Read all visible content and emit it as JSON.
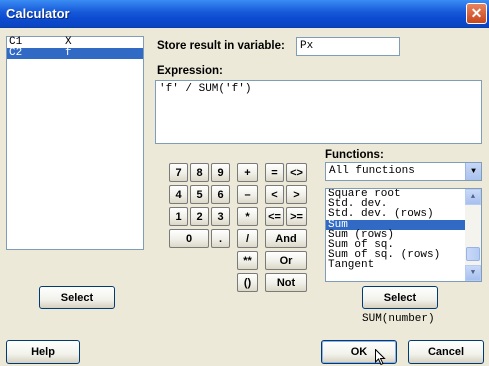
{
  "window": {
    "title": "Calculator",
    "close_glyph": "✕"
  },
  "variables": {
    "rows": [
      {
        "col": "C1",
        "name": "X",
        "selected": false
      },
      {
        "col": "C2",
        "name": "f",
        "selected": true
      }
    ]
  },
  "store": {
    "label": "Store result in variable:",
    "value": "Px"
  },
  "expression": {
    "label": "Expression:",
    "value": "'f' / SUM('f')"
  },
  "keypad": {
    "keys": [
      "7",
      "8",
      "9",
      "+",
      "=",
      "<>",
      "4",
      "5",
      "6",
      "–",
      "<",
      ">",
      "1",
      "2",
      "3",
      "*",
      "<=",
      ">=",
      "0",
      ".",
      "/",
      "And",
      "**",
      "Or",
      "()",
      "Not"
    ]
  },
  "functions": {
    "label": "Functions:",
    "category": "All functions",
    "items": [
      {
        "text": "Square root",
        "selected": false
      },
      {
        "text": "Std. dev.",
        "selected": false
      },
      {
        "text": "Std. dev. (rows)",
        "selected": false
      },
      {
        "text": "Sum",
        "selected": true
      },
      {
        "text": "Sum (rows)",
        "selected": false
      },
      {
        "text": "Sum of sq.",
        "selected": false
      },
      {
        "text": "Sum of sq. (rows)",
        "selected": false
      },
      {
        "text": "Tangent",
        "selected": false
      }
    ],
    "select_label": "Select",
    "syntax_hint": "SUM(number)"
  },
  "buttons": {
    "select_var": "Select",
    "help": "Help",
    "ok": "OK",
    "cancel": "Cancel"
  }
}
